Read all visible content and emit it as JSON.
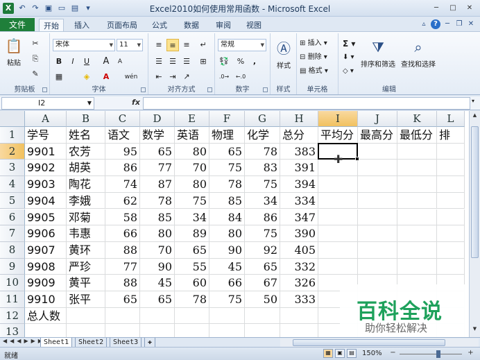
{
  "window": {
    "title": "Excel2010如何使用常用函数 - Microsoft Excel",
    "app_icon": "X",
    "qat_icons": [
      "undo-icon",
      "redo-icon",
      "save-icon",
      "open-icon",
      "print-icon",
      "customize-icon"
    ],
    "controls": {
      "minimize": "─",
      "maximize": "□",
      "close": "✕"
    }
  },
  "tabs": {
    "file": "文件",
    "items": [
      "开始",
      "插入",
      "页面布局",
      "公式",
      "数据",
      "审阅",
      "视图"
    ],
    "active_index": 0
  },
  "ribbon": {
    "clipboard": {
      "label": "剪贴板",
      "paste": "粘贴"
    },
    "font": {
      "label": "字体",
      "name": "宋体",
      "size": "11",
      "bold": "B",
      "italic": "I",
      "underline": "U",
      "grow": "A",
      "shrink": "A",
      "wen": "wén"
    },
    "alignment": {
      "label": "对齐方式"
    },
    "number": {
      "label": "数字",
      "format": "常规",
      "percent": "%",
      "comma": ","
    },
    "styles": {
      "label": "样式",
      "button": "样式"
    },
    "cells": {
      "label": "单元格",
      "insert": "插入",
      "delete": "删除",
      "format": "格式"
    },
    "editing": {
      "label": "编辑",
      "sort_filter": "排序和筛选",
      "find_select": "查找和选择",
      "sigma": "Σ"
    }
  },
  "formula_bar": {
    "name_box": "I2",
    "fx": "fx",
    "formula": ""
  },
  "sheet": {
    "columns": [
      "A",
      "B",
      "C",
      "D",
      "E",
      "F",
      "G",
      "H",
      "I",
      "J",
      "K",
      "L"
    ],
    "selected_column": "I",
    "selected_row": 2,
    "rows": [
      [
        "学号",
        "姓名",
        "语文",
        "数学",
        "英语",
        "物理",
        "化学",
        "总分",
        "平均分",
        "最高分",
        "最低分",
        "排"
      ],
      [
        "9901",
        "农芳",
        "95",
        "65",
        "80",
        "65",
        "78",
        "383",
        "",
        "",
        "",
        ""
      ],
      [
        "9902",
        "胡英",
        "86",
        "77",
        "70",
        "75",
        "83",
        "391",
        "",
        "",
        "",
        ""
      ],
      [
        "9903",
        "陶花",
        "74",
        "87",
        "80",
        "78",
        "75",
        "394",
        "",
        "",
        "",
        ""
      ],
      [
        "9904",
        "李娥",
        "62",
        "78",
        "75",
        "85",
        "34",
        "334",
        "",
        "",
        "",
        ""
      ],
      [
        "9905",
        "邓菊",
        "58",
        "85",
        "34",
        "84",
        "86",
        "347",
        "",
        "",
        "",
        ""
      ],
      [
        "9906",
        "韦惠",
        "66",
        "80",
        "89",
        "80",
        "75",
        "390",
        "",
        "",
        "",
        ""
      ],
      [
        "9907",
        "黄环",
        "88",
        "70",
        "65",
        "90",
        "92",
        "405",
        "",
        "",
        "",
        ""
      ],
      [
        "9908",
        "严珍",
        "77",
        "90",
        "55",
        "45",
        "65",
        "332",
        "",
        "",
        "",
        ""
      ],
      [
        "9909",
        "黄平",
        "88",
        "45",
        "60",
        "66",
        "67",
        "326",
        "",
        "",
        "",
        ""
      ],
      [
        "9910",
        "张平",
        "65",
        "65",
        "78",
        "75",
        "50",
        "333",
        "",
        "",
        "",
        ""
      ],
      [
        "总人数",
        "",
        "",
        "",
        "",
        "",
        "",
        "",
        "",
        "",
        "",
        ""
      ],
      [
        "",
        "",
        "",
        "",
        "",
        "",
        "",
        "",
        "",
        "",
        "",
        ""
      ]
    ]
  },
  "sheet_tabs": [
    "Sheet1",
    "Sheet2",
    "Sheet3"
  ],
  "active_sheet": 0,
  "status": {
    "text": "就绪",
    "zoom": "150%",
    "zoom_fraction": 0.62
  },
  "watermark": {
    "title": "百科全说",
    "subtitle": "助你轻松解决"
  }
}
